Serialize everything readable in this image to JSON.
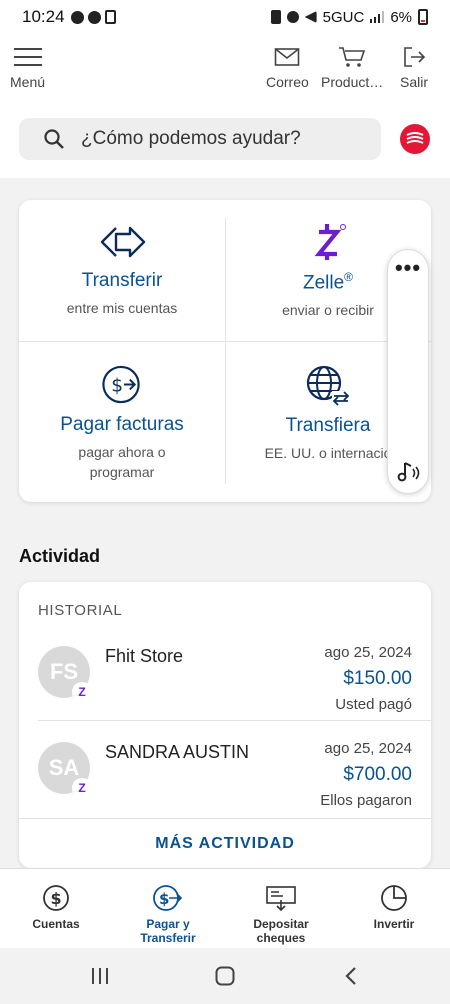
{
  "status_bar": {
    "time": "10:24",
    "network": "5GUC",
    "battery": "6%"
  },
  "header": {
    "menu_label": "Menú",
    "mail_label": "Correo",
    "products_label": "Product…",
    "exit_label": "Salir",
    "search_placeholder": "¿Cómo podemos ayudar?"
  },
  "quick_actions": [
    {
      "title": "Transferir",
      "subtitle": "entre mis cuentas"
    },
    {
      "title": "Zelle",
      "title_mark": "®",
      "subtitle": "enviar o recibir"
    },
    {
      "title": "Pagar facturas",
      "subtitle_line1": "pagar ahora o",
      "subtitle_line2": "programar"
    },
    {
      "title": "Transfiera",
      "subtitle": "EE. UU. o internacio"
    }
  ],
  "activity": {
    "title": "Actividad",
    "section_label": "HISTORIAL",
    "transactions": [
      {
        "initials": "FS",
        "badge": "Z",
        "name": "Fhit Store",
        "date": "ago 25, 2024",
        "amount": "$150.00",
        "note": "Usted pagó"
      },
      {
        "initials": "SA",
        "badge": "Z",
        "name": "SANDRA AUSTIN",
        "date": "ago 25, 2024",
        "amount": "$700.00",
        "note": "Ellos pagaron"
      }
    ],
    "more_label": "MÁS ACTIVIDAD"
  },
  "bottom_nav": [
    {
      "label": "Cuentas",
      "icon": "dollar-circle-icon"
    },
    {
      "label_line1": "Pagar y",
      "label_line2": "Transferir",
      "icon": "pay-transfer-icon",
      "active": true
    },
    {
      "label_line1": "Depositar",
      "label_line2": "cheques",
      "icon": "check-deposit-icon"
    },
    {
      "label": "Invertir",
      "icon": "pie-chart-icon"
    }
  ],
  "colors": {
    "accent": "#0a5291",
    "zelle": "#6d1ed4",
    "brand_red": "#e31837"
  }
}
